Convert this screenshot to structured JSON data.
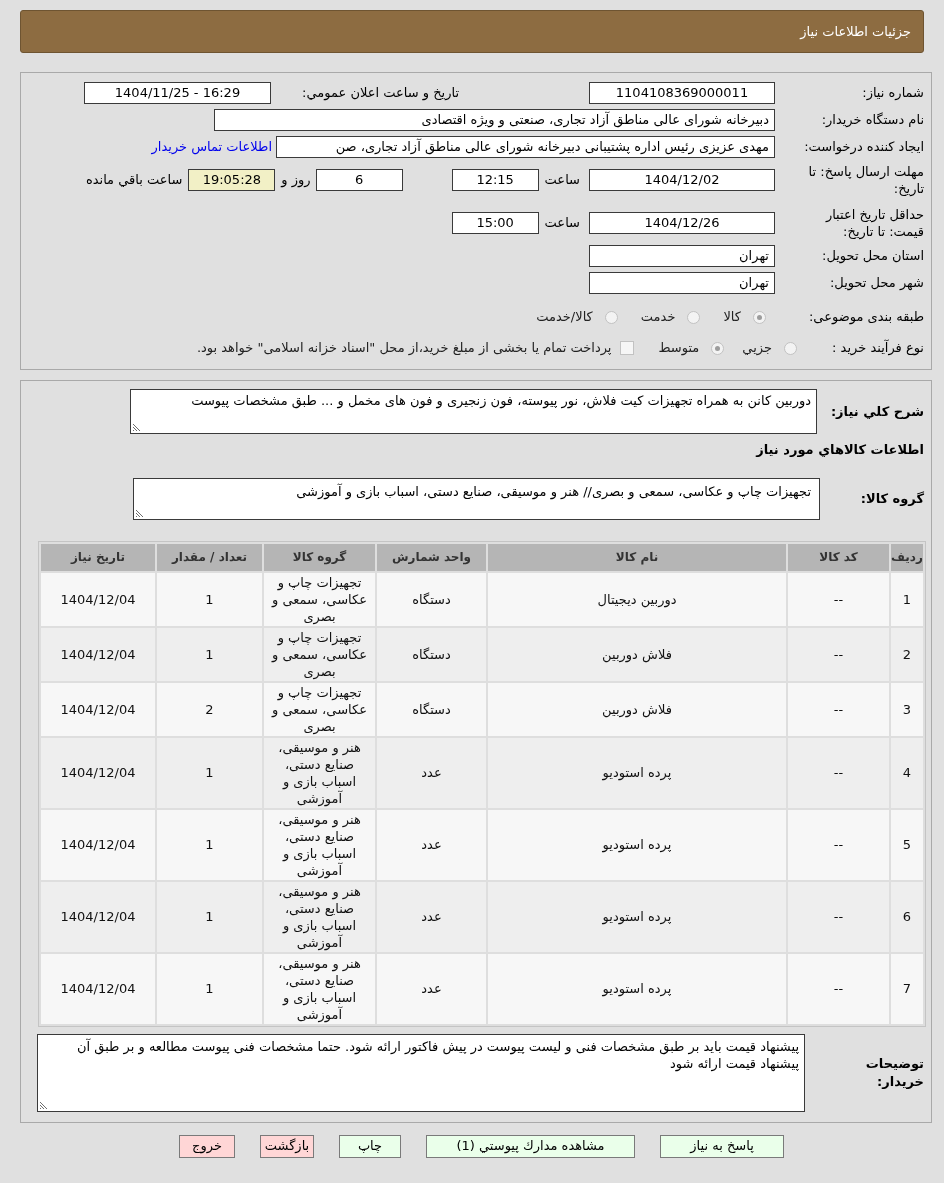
{
  "window": {
    "title": "جزئیات اطلاعات نیاز"
  },
  "summary": {
    "need_number": {
      "label": "شماره نیاز:",
      "value": "1104108369000011"
    },
    "announce": {
      "label": "تاریخ و ساعت اعلان عمومي:",
      "value": "1404/11/25 - 16:29"
    },
    "buyer_org": {
      "label": "نام دستگاه خریدار:",
      "value": "دبیرخانه شورای عالی مناطق آزاد تجاری، صنعتی و ویژه اقتصادی"
    },
    "requester": {
      "label": "ایجاد کننده درخواست:",
      "value": "مهدی عزیزی رئیس اداره پشتیبانی دبیرخانه شورای عالی مناطق آزاد تجاری، صن",
      "contact_link": "اطلاعات تماس خریدار"
    },
    "response_deadline": {
      "label": "مهلت ارسال پاسخ: تا تاریخ:",
      "date": "1404/12/02",
      "time_label": "ساعت",
      "time": "12:15",
      "days": "6",
      "days_label": "روز و",
      "remaining": "19:05:28",
      "remaining_label": "ساعت باقي مانده"
    },
    "price_validity": {
      "label": "حداقل تاريخ اعتبار قیمت: تا تاریخ:",
      "date": "1404/12/26",
      "time_label": "ساعت",
      "time": "15:00"
    },
    "province": {
      "label": "استان محل تحویل:",
      "value": "تهران"
    },
    "city": {
      "label": "شهر محل تحویل:",
      "value": "تهران"
    },
    "category": {
      "label": "طبقه بندی موضوعی:",
      "options": [
        {
          "label": "کالا",
          "selected": true
        },
        {
          "label": "خدمت",
          "selected": false
        },
        {
          "label": "کالا/خدمت",
          "selected": false
        }
      ]
    },
    "purchase_type": {
      "label": "نوع فرآیند خرید :",
      "options": [
        {
          "label": "جزيي",
          "selected": false
        },
        {
          "label": "متوسط",
          "selected": true
        }
      ],
      "treasury": {
        "label": "پرداخت تمام یا بخشی از مبلغ خرید،از محل \"اسناد خزانه اسلامی\" خواهد بود.",
        "checked": false
      }
    }
  },
  "request": {
    "description": {
      "label": "شرح كلي نياز:",
      "value": "دوربین کانن به همراه تجهیزات کیت فلاش، نور پیوسته، فون زنجیری و فون های مخمل و ... طبق مشخصات پیوست"
    },
    "goods_title": "اطلاعات كالاهاي مورد نياز",
    "goods_group": {
      "label": "گروه کالا:",
      "value": "تجهیزات چاپ و عکاسی، سمعی و بصری// هنر و موسیقی، صنایع دستی، اسباب بازی و آموزشی"
    },
    "table": {
      "columns": [
        "ردیف",
        "کد کالا",
        "نام کالا",
        "واحد شمارش",
        "گروه کالا",
        "تعداد / مقدار",
        "تاریخ نیاز"
      ],
      "rows": [
        [
          "1",
          "--",
          "دوربین دیجیتال",
          "دستگاه",
          "تجهیزات چاپ و عکاسی، سمعی و بصری",
          "1",
          "1404/12/04"
        ],
        [
          "2",
          "--",
          "فلاش دوربین",
          "دستگاه",
          "تجهیزات چاپ و عکاسی، سمعی و بصری",
          "1",
          "1404/12/04"
        ],
        [
          "3",
          "--",
          "فلاش دوربین",
          "دستگاه",
          "تجهیزات چاپ و عکاسی، سمعی و بصری",
          "2",
          "1404/12/04"
        ],
        [
          "4",
          "--",
          "پرده استودیو",
          "عدد",
          "هنر و موسیقی، صنایع دستی، اسباب بازی و آموزشی",
          "1",
          "1404/12/04"
        ],
        [
          "5",
          "--",
          "پرده استودیو",
          "عدد",
          "هنر و موسیقی، صنایع دستی، اسباب بازی و آموزشی",
          "1",
          "1404/12/04"
        ],
        [
          "6",
          "--",
          "پرده استودیو",
          "عدد",
          "هنر و موسیقی، صنایع دستی، اسباب بازی و آموزشی",
          "1",
          "1404/12/04"
        ],
        [
          "7",
          "--",
          "پرده استودیو",
          "عدد",
          "هنر و موسیقی، صنایع دستی، اسباب بازی و آموزشی",
          "1",
          "1404/12/04"
        ]
      ]
    },
    "buyer_notes": {
      "label": "توضیحات خریدار:",
      "value": "پیشنهاد قیمت باید بر طبق مشخصات فنی و لیست پیوست در پیش فاکتور ارائه شود. حتما مشخصات فنی پیوست مطالعه و بر طبق آن پیشنهاد قیمت ارائه شود"
    }
  },
  "buttons": [
    {
      "label": "پاسخ به نیاز",
      "kind": "confirm"
    },
    {
      "label": "مشاهده مدارك پيوستي (1)",
      "kind": "confirm"
    },
    {
      "label": "چاپ",
      "kind": "confirm"
    },
    {
      "label": "بازگشت",
      "kind": "cancel"
    },
    {
      "label": "خروج",
      "kind": "cancel"
    }
  ]
}
